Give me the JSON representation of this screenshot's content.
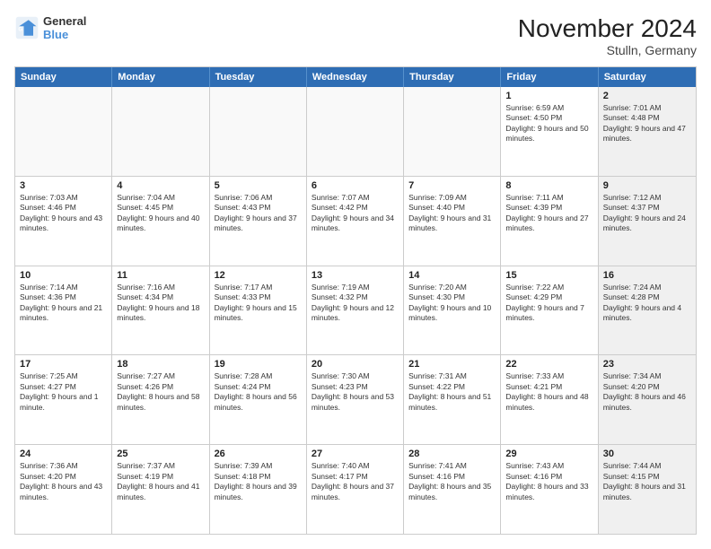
{
  "header": {
    "logo_general": "General",
    "logo_blue": "Blue",
    "title": "November 2024",
    "subtitle": "Stulln, Germany"
  },
  "weekdays": [
    "Sunday",
    "Monday",
    "Tuesday",
    "Wednesday",
    "Thursday",
    "Friday",
    "Saturday"
  ],
  "rows": [
    [
      {
        "day": "",
        "info": "",
        "shaded": false,
        "empty": true
      },
      {
        "day": "",
        "info": "",
        "shaded": false,
        "empty": true
      },
      {
        "day": "",
        "info": "",
        "shaded": false,
        "empty": true
      },
      {
        "day": "",
        "info": "",
        "shaded": false,
        "empty": true
      },
      {
        "day": "",
        "info": "",
        "shaded": false,
        "empty": true
      },
      {
        "day": "1",
        "info": "Sunrise: 6:59 AM\nSunset: 4:50 PM\nDaylight: 9 hours and 50 minutes.",
        "shaded": false,
        "empty": false
      },
      {
        "day": "2",
        "info": "Sunrise: 7:01 AM\nSunset: 4:48 PM\nDaylight: 9 hours and 47 minutes.",
        "shaded": true,
        "empty": false
      }
    ],
    [
      {
        "day": "3",
        "info": "Sunrise: 7:03 AM\nSunset: 4:46 PM\nDaylight: 9 hours and 43 minutes.",
        "shaded": false,
        "empty": false
      },
      {
        "day": "4",
        "info": "Sunrise: 7:04 AM\nSunset: 4:45 PM\nDaylight: 9 hours and 40 minutes.",
        "shaded": false,
        "empty": false
      },
      {
        "day": "5",
        "info": "Sunrise: 7:06 AM\nSunset: 4:43 PM\nDaylight: 9 hours and 37 minutes.",
        "shaded": false,
        "empty": false
      },
      {
        "day": "6",
        "info": "Sunrise: 7:07 AM\nSunset: 4:42 PM\nDaylight: 9 hours and 34 minutes.",
        "shaded": false,
        "empty": false
      },
      {
        "day": "7",
        "info": "Sunrise: 7:09 AM\nSunset: 4:40 PM\nDaylight: 9 hours and 31 minutes.",
        "shaded": false,
        "empty": false
      },
      {
        "day": "8",
        "info": "Sunrise: 7:11 AM\nSunset: 4:39 PM\nDaylight: 9 hours and 27 minutes.",
        "shaded": false,
        "empty": false
      },
      {
        "day": "9",
        "info": "Sunrise: 7:12 AM\nSunset: 4:37 PM\nDaylight: 9 hours and 24 minutes.",
        "shaded": true,
        "empty": false
      }
    ],
    [
      {
        "day": "10",
        "info": "Sunrise: 7:14 AM\nSunset: 4:36 PM\nDaylight: 9 hours and 21 minutes.",
        "shaded": false,
        "empty": false
      },
      {
        "day": "11",
        "info": "Sunrise: 7:16 AM\nSunset: 4:34 PM\nDaylight: 9 hours and 18 minutes.",
        "shaded": false,
        "empty": false
      },
      {
        "day": "12",
        "info": "Sunrise: 7:17 AM\nSunset: 4:33 PM\nDaylight: 9 hours and 15 minutes.",
        "shaded": false,
        "empty": false
      },
      {
        "day": "13",
        "info": "Sunrise: 7:19 AM\nSunset: 4:32 PM\nDaylight: 9 hours and 12 minutes.",
        "shaded": false,
        "empty": false
      },
      {
        "day": "14",
        "info": "Sunrise: 7:20 AM\nSunset: 4:30 PM\nDaylight: 9 hours and 10 minutes.",
        "shaded": false,
        "empty": false
      },
      {
        "day": "15",
        "info": "Sunrise: 7:22 AM\nSunset: 4:29 PM\nDaylight: 9 hours and 7 minutes.",
        "shaded": false,
        "empty": false
      },
      {
        "day": "16",
        "info": "Sunrise: 7:24 AM\nSunset: 4:28 PM\nDaylight: 9 hours and 4 minutes.",
        "shaded": true,
        "empty": false
      }
    ],
    [
      {
        "day": "17",
        "info": "Sunrise: 7:25 AM\nSunset: 4:27 PM\nDaylight: 9 hours and 1 minute.",
        "shaded": false,
        "empty": false
      },
      {
        "day": "18",
        "info": "Sunrise: 7:27 AM\nSunset: 4:26 PM\nDaylight: 8 hours and 58 minutes.",
        "shaded": false,
        "empty": false
      },
      {
        "day": "19",
        "info": "Sunrise: 7:28 AM\nSunset: 4:24 PM\nDaylight: 8 hours and 56 minutes.",
        "shaded": false,
        "empty": false
      },
      {
        "day": "20",
        "info": "Sunrise: 7:30 AM\nSunset: 4:23 PM\nDaylight: 8 hours and 53 minutes.",
        "shaded": false,
        "empty": false
      },
      {
        "day": "21",
        "info": "Sunrise: 7:31 AM\nSunset: 4:22 PM\nDaylight: 8 hours and 51 minutes.",
        "shaded": false,
        "empty": false
      },
      {
        "day": "22",
        "info": "Sunrise: 7:33 AM\nSunset: 4:21 PM\nDaylight: 8 hours and 48 minutes.",
        "shaded": false,
        "empty": false
      },
      {
        "day": "23",
        "info": "Sunrise: 7:34 AM\nSunset: 4:20 PM\nDaylight: 8 hours and 46 minutes.",
        "shaded": true,
        "empty": false
      }
    ],
    [
      {
        "day": "24",
        "info": "Sunrise: 7:36 AM\nSunset: 4:20 PM\nDaylight: 8 hours and 43 minutes.",
        "shaded": false,
        "empty": false
      },
      {
        "day": "25",
        "info": "Sunrise: 7:37 AM\nSunset: 4:19 PM\nDaylight: 8 hours and 41 minutes.",
        "shaded": false,
        "empty": false
      },
      {
        "day": "26",
        "info": "Sunrise: 7:39 AM\nSunset: 4:18 PM\nDaylight: 8 hours and 39 minutes.",
        "shaded": false,
        "empty": false
      },
      {
        "day": "27",
        "info": "Sunrise: 7:40 AM\nSunset: 4:17 PM\nDaylight: 8 hours and 37 minutes.",
        "shaded": false,
        "empty": false
      },
      {
        "day": "28",
        "info": "Sunrise: 7:41 AM\nSunset: 4:16 PM\nDaylight: 8 hours and 35 minutes.",
        "shaded": false,
        "empty": false
      },
      {
        "day": "29",
        "info": "Sunrise: 7:43 AM\nSunset: 4:16 PM\nDaylight: 8 hours and 33 minutes.",
        "shaded": false,
        "empty": false
      },
      {
        "day": "30",
        "info": "Sunrise: 7:44 AM\nSunset: 4:15 PM\nDaylight: 8 hours and 31 minutes.",
        "shaded": true,
        "empty": false
      }
    ]
  ]
}
